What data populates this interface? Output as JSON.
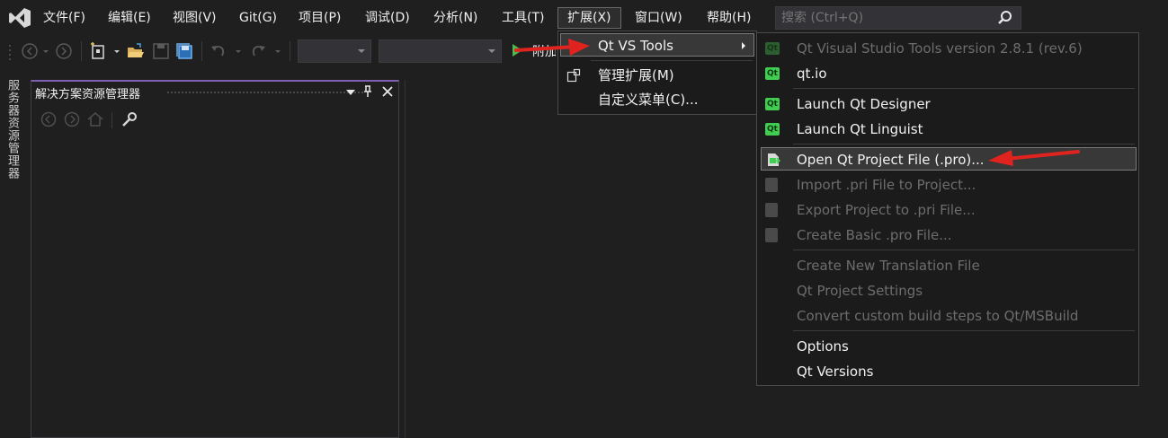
{
  "menubar": {
    "items": [
      "文件(F)",
      "编辑(E)",
      "视图(V)",
      "Git(G)",
      "项目(P)",
      "调试(D)",
      "分析(N)",
      "工具(T)",
      "扩展(X)",
      "窗口(W)",
      "帮助(H)"
    ],
    "search_placeholder": "搜索 (Ctrl+Q)"
  },
  "toolbar": {
    "attach_label": "附加"
  },
  "side_tab": {
    "label": "服务器资源管理器"
  },
  "solution_explorer": {
    "title": "解决方案资源管理器"
  },
  "extensions_menu": {
    "items": [
      {
        "label": "Qt VS Tools",
        "icon": "none",
        "submenu": true,
        "highlighted": true
      },
      {
        "label": "管理扩展(M)",
        "icon": "manage-extensions-icon"
      },
      {
        "label": "自定义菜单(C)...",
        "icon": "none"
      }
    ]
  },
  "qt_menu": {
    "items": [
      {
        "label": "Qt Visual Studio Tools version 2.8.1 (rev.6)",
        "disabled": true
      },
      {
        "label": "qt.io",
        "disabled": false
      },
      {
        "label": "Launch Qt Designer",
        "disabled": false
      },
      {
        "label": "Launch Qt Linguist",
        "disabled": false
      },
      {
        "label": "Open Qt Project File (.pro)...",
        "disabled": false,
        "highlighted": true
      },
      {
        "label": "Import .pri File to Project...",
        "disabled": true
      },
      {
        "label": "Export Project to .pri File...",
        "disabled": true
      },
      {
        "label": "Create Basic .pro File...",
        "disabled": true
      },
      {
        "label": "Create New Translation File",
        "disabled": true
      },
      {
        "label": "Qt Project Settings",
        "disabled": true
      },
      {
        "label": "Convert custom build steps to Qt/MSBuild",
        "disabled": true
      },
      {
        "label": "Options",
        "disabled": false
      },
      {
        "label": "Qt Versions",
        "disabled": false
      }
    ]
  },
  "colors": {
    "background": "#1f1f1f",
    "menu_background": "#1b1b1c",
    "accent_purple": "#7e5fb0",
    "qt_green": "#41cd52",
    "annotation_red": "#e0231f"
  }
}
